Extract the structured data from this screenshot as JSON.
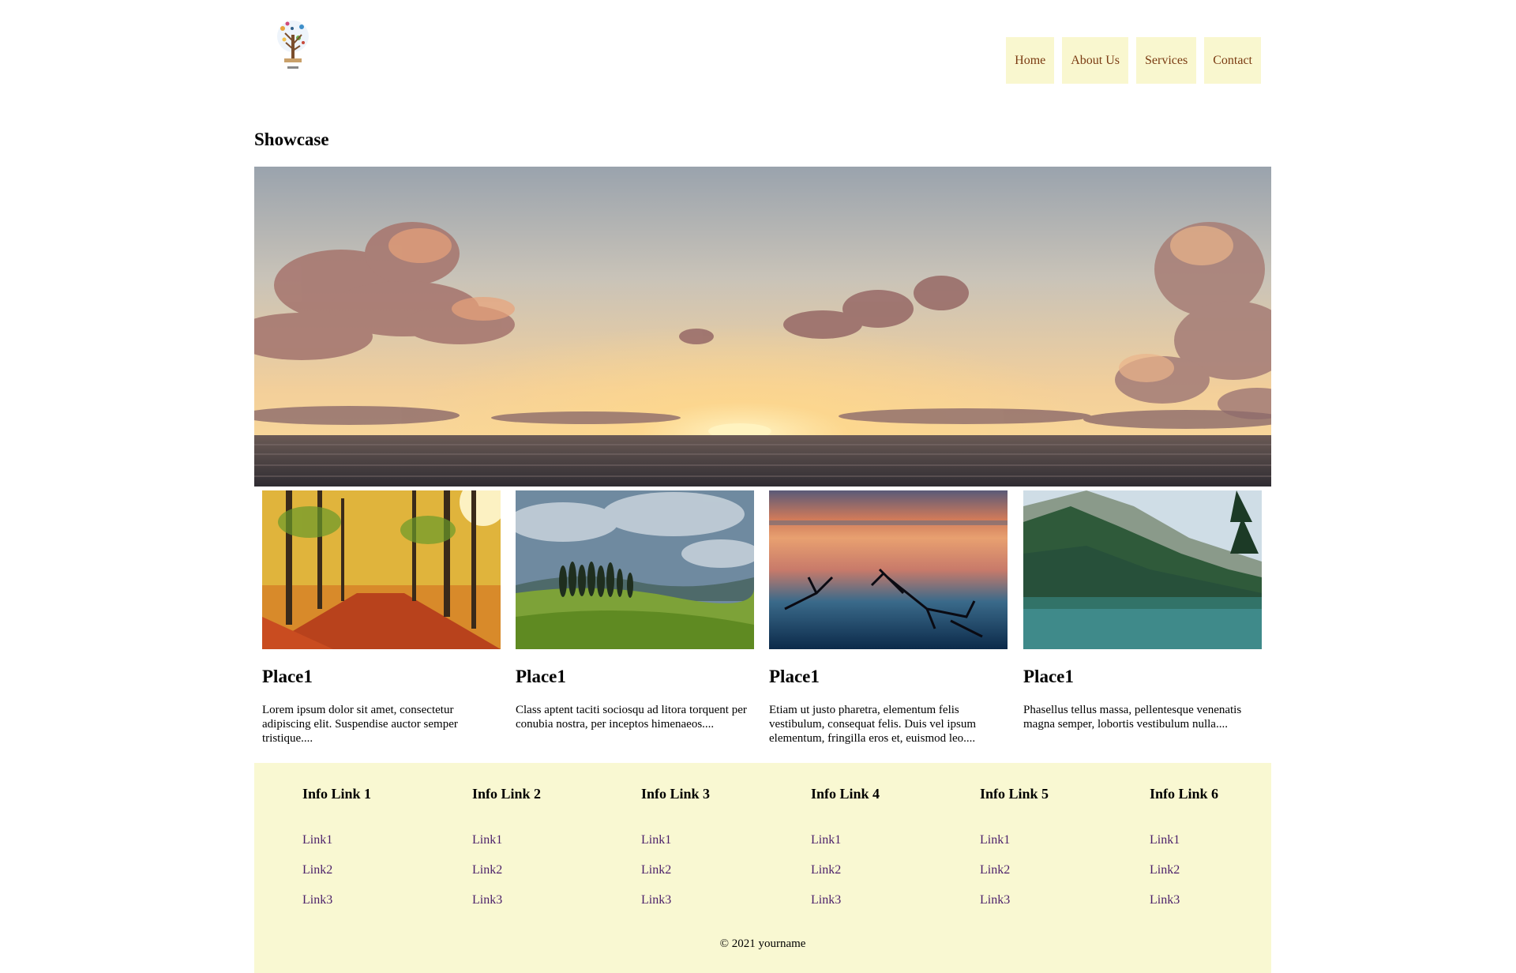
{
  "header": {
    "logo_icon": "tree-logo-icon",
    "nav": [
      {
        "label": "Home"
      },
      {
        "label": "About Us"
      },
      {
        "label": "Services"
      },
      {
        "label": "Contact"
      }
    ]
  },
  "showcase": {
    "title": "Showcase",
    "hero_image": "sunset-over-sea"
  },
  "cards": [
    {
      "image": "autumn-forest",
      "title": "Place1",
      "text": "Lorem ipsum dolor sit amet, consectetur adipiscing elit. Suspendise auctor semper tristique...."
    },
    {
      "image": "green-hills-cypress",
      "title": "Place1",
      "text": "Class aptent taciti sociosqu ad litora torquent per conubia nostra, per inceptos himenaeos...."
    },
    {
      "image": "lake-sunset-branches",
      "title": "Place1",
      "text": "Etiam ut justo pharetra, elementum felis vestibulum, consequat felis. Duis vel ipsum elementum, fringilla eros et, euismod leo...."
    },
    {
      "image": "mountain-lake",
      "title": "Place1",
      "text": "Phasellus tellus massa, pellentesque venenatis magna semper, lobortis vestibulum nulla...."
    }
  ],
  "footer": {
    "columns": [
      {
        "title": "Info Link 1",
        "links": [
          "Link1",
          "Link2",
          "Link3"
        ]
      },
      {
        "title": "Info Link 2",
        "links": [
          "Link1",
          "Link2",
          "Link3"
        ]
      },
      {
        "title": "Info Link 3",
        "links": [
          "Link1",
          "Link2",
          "Link3"
        ]
      },
      {
        "title": "Info Link 4",
        "links": [
          "Link1",
          "Link2",
          "Link3"
        ]
      },
      {
        "title": "Info Link 5",
        "links": [
          "Link1",
          "Link2",
          "Link3"
        ]
      },
      {
        "title": "Info Link 6",
        "links": [
          "Link1",
          "Link2",
          "Link3"
        ]
      }
    ],
    "copyright": "© 2021 yourname"
  },
  "colors": {
    "nav_bg": "#f9f7cf",
    "nav_text": "#7a3b12",
    "footer_bg": "#f9f8d2",
    "link": "#4a1f6a"
  }
}
